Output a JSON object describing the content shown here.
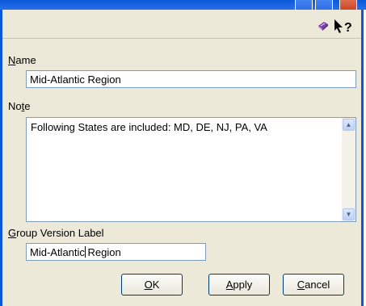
{
  "toolbar": {
    "help_icon": "help-book-icon",
    "whats_this_icon": "whats-this-help-icon"
  },
  "name": {
    "label_key": "N",
    "label_rest": "ame",
    "value": "Mid-Atlantic Region"
  },
  "note": {
    "label_pre": "No",
    "label_key": "t",
    "label_rest": "e",
    "value": "Following States are included: MD, DE, NJ, PA, VA"
  },
  "group_version": {
    "label_key": "G",
    "label_rest": "roup Version Label",
    "value_before_caret": "Mid-Atlantic",
    "value_after_caret": " Region"
  },
  "buttons": {
    "ok_key": "O",
    "ok_rest": "K",
    "apply_key": "A",
    "apply_rest": "pply",
    "cancel_key": "C",
    "cancel_rest": "ancel"
  }
}
